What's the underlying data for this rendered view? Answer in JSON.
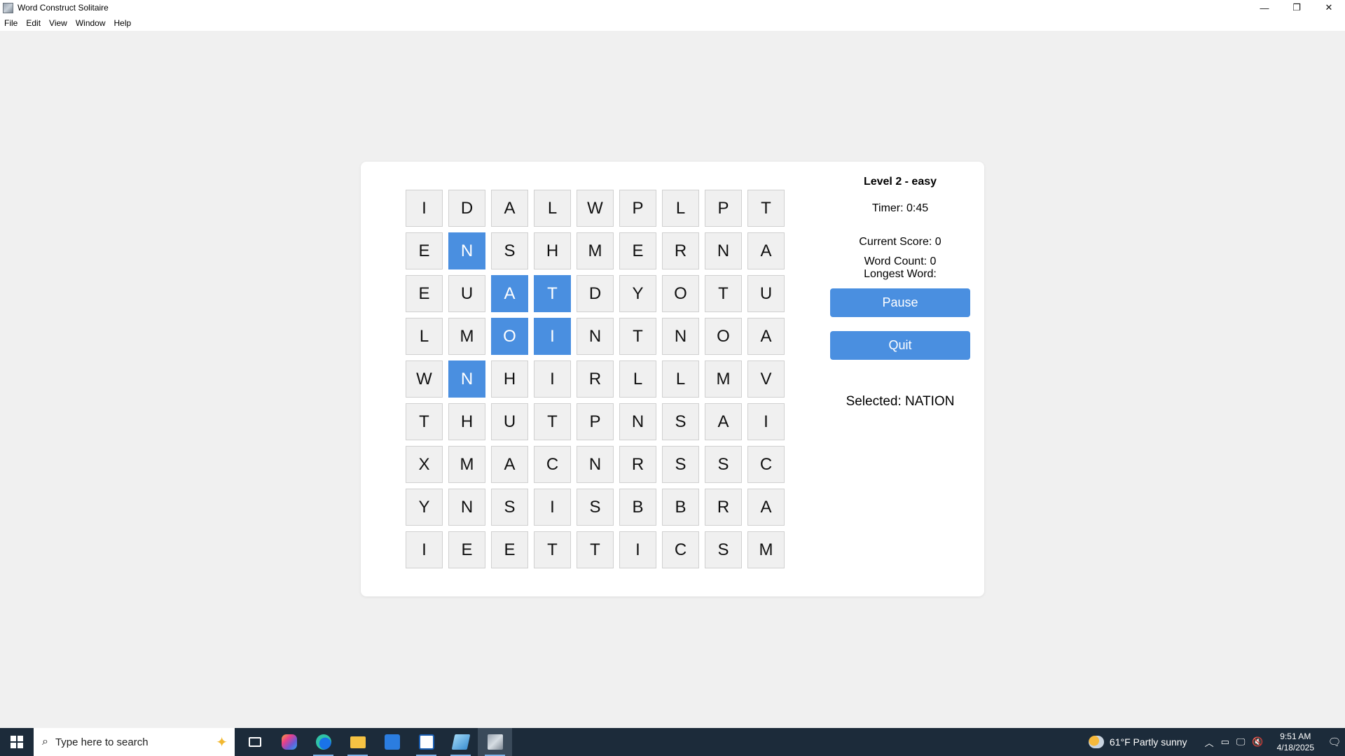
{
  "window": {
    "title": "Word Construct Solitaire",
    "controls": {
      "minimize": "—",
      "maximize": "❐",
      "close": "✕"
    }
  },
  "menu": [
    "File",
    "Edit",
    "View",
    "Window",
    "Help"
  ],
  "grid": [
    [
      "I",
      "D",
      "A",
      "L",
      "W",
      "P",
      "L",
      "P",
      "T"
    ],
    [
      "E",
      "N",
      "S",
      "H",
      "M",
      "E",
      "R",
      "N",
      "A"
    ],
    [
      "E",
      "U",
      "A",
      "T",
      "D",
      "Y",
      "O",
      "T",
      "U"
    ],
    [
      "L",
      "M",
      "O",
      "I",
      "N",
      "T",
      "N",
      "O",
      "A"
    ],
    [
      "W",
      "N",
      "H",
      "I",
      "R",
      "L",
      "L",
      "M",
      "V"
    ],
    [
      "T",
      "H",
      "U",
      "T",
      "P",
      "N",
      "S",
      "A",
      "I"
    ],
    [
      "X",
      "M",
      "A",
      "C",
      "N",
      "R",
      "S",
      "S",
      "C"
    ],
    [
      "Y",
      "N",
      "S",
      "I",
      "S",
      "B",
      "B",
      "R",
      "A"
    ],
    [
      "I",
      "E",
      "E",
      "T",
      "T",
      "I",
      "C",
      "S",
      "M"
    ]
  ],
  "selected_cells": [
    [
      1,
      1
    ],
    [
      2,
      2
    ],
    [
      2,
      3
    ],
    [
      3,
      2
    ],
    [
      3,
      3
    ],
    [
      4,
      1
    ]
  ],
  "selected_color": "#4a8fe0",
  "panel": {
    "level": "Level 2 - easy",
    "timer": "Timer: 0:45",
    "score": "Current Score: 0",
    "word_count": "Word Count: 0",
    "longest_word": "Longest Word:",
    "pause_label": "Pause",
    "quit_label": "Quit",
    "selected": "Selected: NATION"
  },
  "taskbar": {
    "search_placeholder": "Type here to search",
    "weather": "61°F  Partly sunny",
    "time": "9:51 AM",
    "date": "4/18/2025",
    "icons": [
      "task-view-icon",
      "copilot-icon",
      "edge-icon",
      "file-explorer-icon",
      "store-icon",
      "solitaire-icon",
      "notepad-icon",
      "word-construct-icon"
    ]
  }
}
